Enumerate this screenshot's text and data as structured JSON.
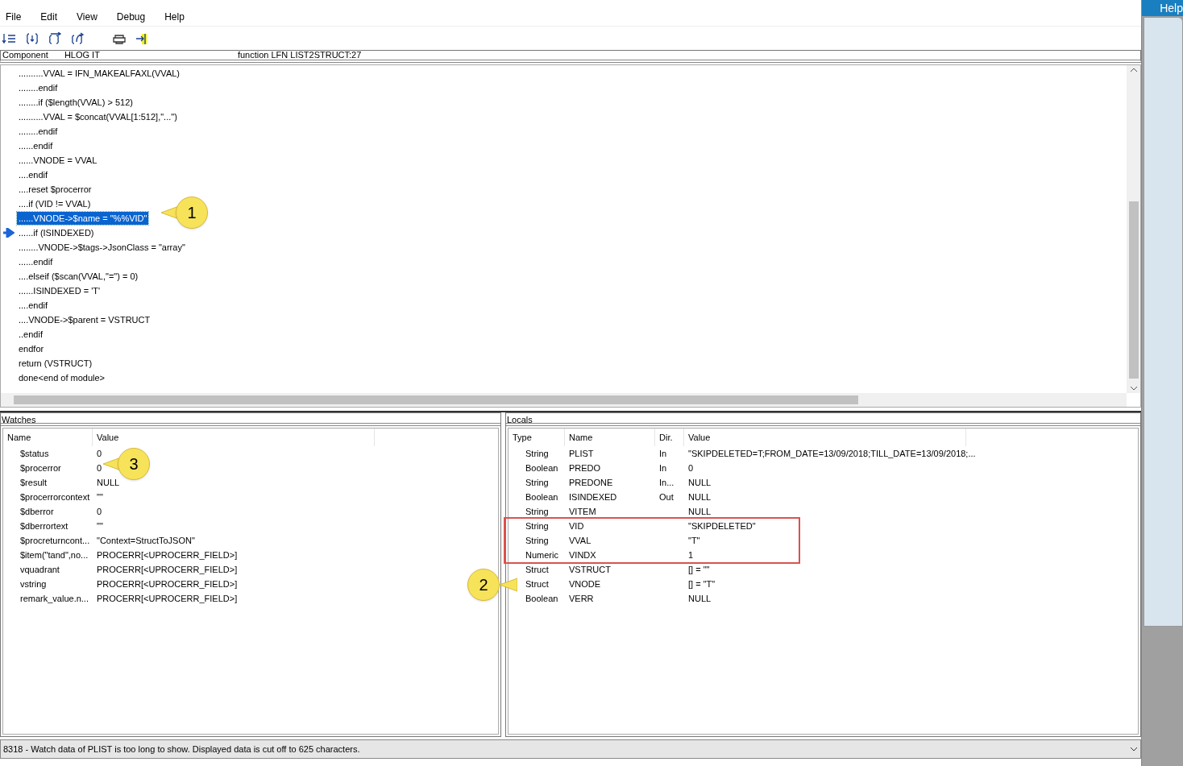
{
  "menu": [
    {
      "label": "File"
    },
    {
      "label": "Edit"
    },
    {
      "label": "View"
    },
    {
      "label": "Debug"
    },
    {
      "label": "Help"
    }
  ],
  "header": {
    "label": "Component",
    "component": "HLOG IT",
    "function": "function LFN  LIST2STRUCT:27"
  },
  "code_lines": [
    {
      "text": "..........VVAL = IFN_MAKEALFAXL(VVAL)",
      "selected": false,
      "current": false
    },
    {
      "text": "........endif",
      "selected": false,
      "current": false
    },
    {
      "text": "........if ($length(VVAL) > 512)",
      "selected": false,
      "current": false
    },
    {
      "text": "..........VVAL = $concat(VVAL[1:512],\"...\")",
      "selected": false,
      "current": false
    },
    {
      "text": "........endif",
      "selected": false,
      "current": false
    },
    {
      "text": "......endif",
      "selected": false,
      "current": false
    },
    {
      "text": "......VNODE = VVAL",
      "selected": false,
      "current": false
    },
    {
      "text": "....endif",
      "selected": false,
      "current": false
    },
    {
      "text": "....reset $procerror",
      "selected": false,
      "current": false
    },
    {
      "text": "....if (VID != VVAL)",
      "selected": false,
      "current": false
    },
    {
      "text": "......VNODE->$name = \"%%VID\"",
      "selected": true,
      "current": false
    },
    {
      "text": "......if (ISINDEXED)",
      "selected": false,
      "current": true
    },
    {
      "text": "........VNODE->$tags->JsonClass = \"array\"",
      "selected": false,
      "current": false
    },
    {
      "text": "......endif",
      "selected": false,
      "current": false
    },
    {
      "text": "....elseif ($scan(VVAL,\"=\") = 0)",
      "selected": false,
      "current": false
    },
    {
      "text": "......ISINDEXED = 'T'",
      "selected": false,
      "current": false
    },
    {
      "text": "....endif",
      "selected": false,
      "current": false
    },
    {
      "text": "....VNODE->$parent = VSTRUCT",
      "selected": false,
      "current": false
    },
    {
      "text": "..endif",
      "selected": false,
      "current": false
    },
    {
      "text": "endfor",
      "selected": false,
      "current": false
    },
    {
      "text": "return (VSTRUCT)",
      "selected": false,
      "current": false
    },
    {
      "text": "done<end of module>",
      "selected": false,
      "current": false
    }
  ],
  "watches": {
    "title": "Watches",
    "columns": [
      "Name",
      "Value"
    ],
    "rows": [
      [
        "$status",
        "0"
      ],
      [
        "$procerror",
        "0"
      ],
      [
        "$result",
        "NULL"
      ],
      [
        "$procerrorcontext",
        "\"\""
      ],
      [
        "$dberror",
        "0"
      ],
      [
        "$dberrortext",
        "\"\""
      ],
      [
        "$procreturncont...",
        "\"Context=StructToJSON\""
      ],
      [
        "$item(\"tand\",no...",
        "PROCERR[<UPROCERR_FIELD>]"
      ],
      [
        "vquadrant",
        "PROCERR[<UPROCERR_FIELD>]"
      ],
      [
        "vstring",
        "PROCERR[<UPROCERR_FIELD>]"
      ],
      [
        "remark_value.n...",
        "PROCERR[<UPROCERR_FIELD>]"
      ]
    ]
  },
  "locals": {
    "title": "Locals",
    "columns": [
      "Type",
      "Name",
      "Dir.",
      "Value"
    ],
    "rows": [
      [
        "String",
        "PLIST",
        "In",
        "\"SKIPDELETED=T;FROM_DATE=13/09/2018;TILL_DATE=13/09/2018;..."
      ],
      [
        "Boolean",
        "PREDO",
        "In",
        "0"
      ],
      [
        "String",
        "PREDONE",
        "In...",
        "NULL"
      ],
      [
        "Boolean",
        "ISINDEXED",
        "Out",
        "NULL"
      ],
      [
        "String",
        "VITEM",
        "",
        "NULL"
      ],
      [
        "String",
        "VID",
        "",
        "\"SKIPDELETED\""
      ],
      [
        "String",
        "VVAL",
        "",
        "\"T\""
      ],
      [
        "Numeric",
        "VINDX",
        "",
        "1"
      ],
      [
        "Struct",
        "VSTRUCT",
        "",
        "[] = \"\""
      ],
      [
        "Struct",
        "VNODE",
        "",
        "[] = \"T\""
      ],
      [
        "Boolean",
        "VERR",
        "",
        "NULL"
      ]
    ]
  },
  "callouts": [
    {
      "label": "1"
    },
    {
      "label": "2"
    },
    {
      "label": "3"
    }
  ],
  "status_bar": {
    "message": "8318 - Watch data of PLIST is too long to show. Displayed data is cut off to 625 characters."
  },
  "background_window": {
    "title": "Help"
  }
}
